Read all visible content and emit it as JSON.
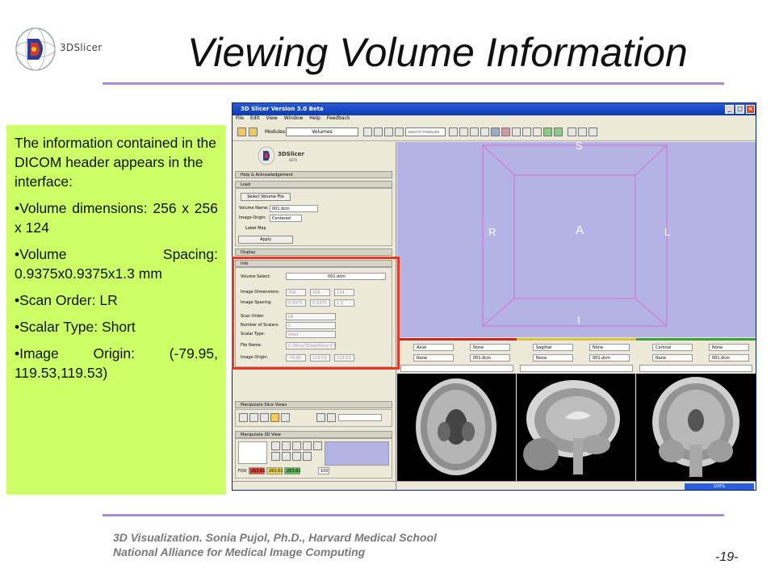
{
  "slide": {
    "title": "Viewing Volume Information",
    "logo_text": "3DSlicer",
    "footer_line1": "3D Visualization. Sonia Pujol, Ph.D., Harvard Medical School",
    "footer_line2": "National Alliance for Medical Image Computing",
    "page_number": "-19-",
    "accent_color": "#a98cd8",
    "box_color": "#ccff66",
    "highlight_color": "#e5391f"
  },
  "info_box": {
    "intro": "The information contained in the DICOM header appears in the interface:",
    "bullets": [
      "•Volume dimensions: 256 x 256 x 124",
      "•Volume Spacing: 0.9375x0.9375x1.3 mm",
      "•Scan Order: LR",
      "•Scalar Type: Short",
      "•Image Origin: (-79.95, 119.53,119.53)"
    ]
  },
  "app": {
    "window_title": "3D Slicer Version 3.0 Beta",
    "menu": [
      "File",
      "Edit",
      "View",
      "Window",
      "Help",
      "Feedback"
    ],
    "modules_label": "Modules:",
    "modules_value": "Volumes",
    "search_placeholder": "search modules",
    "panel_logo": "3DSlicer",
    "panel_logo_sub": "BETA",
    "sections": {
      "help": "Help & Acknowledgement",
      "load": "Load",
      "display": "Display",
      "info": "Info",
      "manip_slice": "Manipulate Slice Views",
      "manip_3d": "Manipulate 3D View"
    },
    "load": {
      "select_button": "Select Volume File",
      "volume_name_label": "Volume Name:",
      "volume_name_value": "001.dcm",
      "image_origin_label": "Image Origin:",
      "image_origin_value": "Centered",
      "label_map": "Label Map",
      "apply": "Apply"
    },
    "info": {
      "volume_select_label": "Volume Select:",
      "volume_select_value": "001.dcm",
      "dimensions_label": "Image Dimensions:",
      "dimensions": [
        "256",
        "256",
        "124"
      ],
      "spacing_label": "Image Spacing:",
      "spacing": [
        "0.9375",
        "0.9375",
        "1.3"
      ],
      "scan_order_label": "Scan Order:",
      "scan_order": "LR",
      "num_scalars_label": "Number of Scalars:",
      "num_scalars": "1",
      "scalar_type_label": "Scalar Type:",
      "scalar_type": "short",
      "file_name_label": "File Name:",
      "file_name": "C:/Slicer3Data/Slicer3.Tr",
      "origin_label": "Image Origin:",
      "origin": [
        "-79.95",
        "119.53",
        "119.53"
      ]
    },
    "fov_label": "FOV:",
    "fov_values": [
      "263.61",
      "263.61",
      "263.61"
    ],
    "zoom_value": "100",
    "view3d_axes": {
      "superior": "S",
      "inferior": "I",
      "right": "R",
      "left": "L",
      "anterior": "A"
    },
    "view3d_bg": "#b3b3e6",
    "slices": [
      {
        "orientation": "Axial",
        "fg": "None",
        "bg": "None",
        "label": "001.dcm",
        "color": "#cc2222"
      },
      {
        "orientation": "Sagittal",
        "fg": "None",
        "bg": "None",
        "label": "001.dcm",
        "color": "#d8c23a"
      },
      {
        "orientation": "Coronal",
        "fg": "None",
        "bg": "None",
        "label": "001.dcm",
        "color": "#3aa13a"
      }
    ],
    "progress": "100%"
  }
}
